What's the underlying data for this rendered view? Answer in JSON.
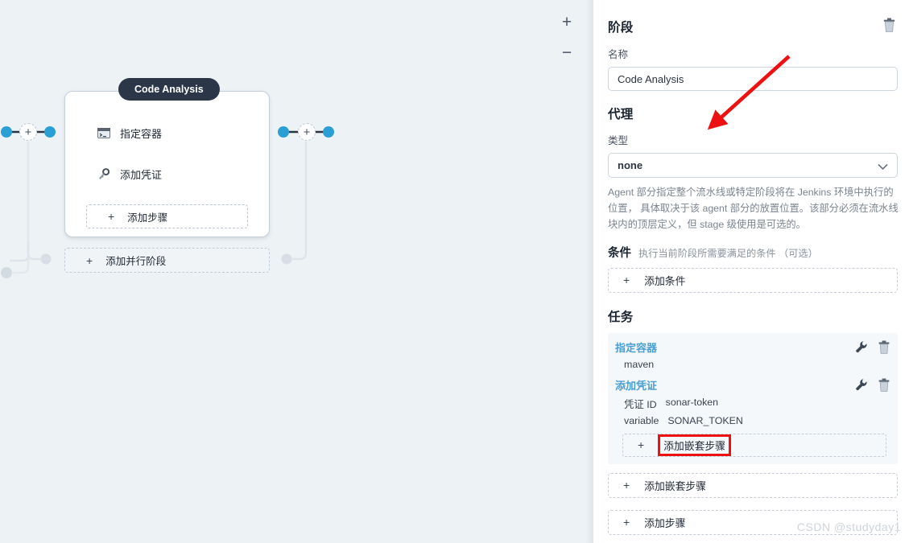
{
  "canvas": {
    "zoom_in_label": "+",
    "zoom_out_label": "−",
    "stage": {
      "title": "Code Analysis",
      "steps": [
        {
          "icon": "terminal-icon",
          "label": "指定容器"
        },
        {
          "icon": "key-icon",
          "label": "添加凭证"
        }
      ],
      "add_step_label": "添加步骤",
      "plus_label": "+"
    },
    "add_parallel_label": "添加并行阶段",
    "add_parallel_plus": "+",
    "node_plus_label": "+",
    "colors": {
      "background": "#edf2f5",
      "badge": "#2b3648",
      "connector_dot": "#2b9fd4",
      "connector_line": "#2a3441"
    }
  },
  "panel": {
    "stage_section_title": "阶段",
    "delete_stage_icon": "trash-icon",
    "name_label": "名称",
    "name_value": "Code Analysis",
    "name_placeholder": "Code Analysis",
    "agent_section_title": "代理",
    "type_label": "类型",
    "type_value": "none",
    "type_options": [
      "none"
    ],
    "agent_description": "Agent 部分指定整个流水线或特定阶段将在 Jenkins 环境中执行的位置， 具体取决于该 agent 部分的放置位置。该部分必须在流水线块内的顶层定义，但 stage 级使用是可选的。",
    "condition_title": "条件",
    "condition_subtitle": "执行当前阶段所需要满足的条件 （可选）",
    "add_condition_label": "添加条件",
    "add_condition_plus": "+",
    "tasks_section_title": "任务",
    "task_block": {
      "container_task": {
        "name": "指定容器",
        "value": "maven",
        "edit_icon": "wrench-icon",
        "delete_icon": "trash-icon"
      },
      "credential_task": {
        "name": "添加凭证",
        "edit_icon": "wrench-icon",
        "delete_icon": "trash-icon",
        "fields": [
          {
            "key": "凭证 ID",
            "value": "sonar-token"
          },
          {
            "key": "variable",
            "value": "SONAR_TOKEN"
          }
        ]
      },
      "inner_nested_label": "添加嵌套步骤",
      "inner_nested_plus": "+"
    },
    "outer_nested_label": "添加嵌套步骤",
    "outer_nested_plus": "+",
    "outer_step_label": "添加步骤",
    "outer_step_plus": "+",
    "watermark": "CSDN @studyday1",
    "highlight_color": "#ee1111"
  }
}
